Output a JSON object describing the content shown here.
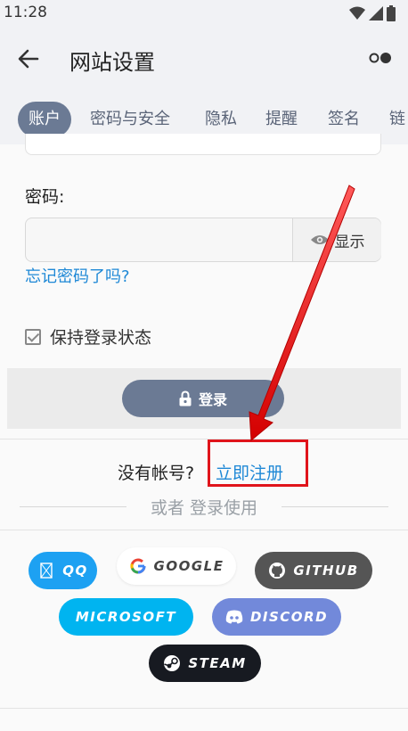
{
  "status": {
    "time": "11:28"
  },
  "header": {
    "title": "网站设置"
  },
  "tabs": [
    {
      "label": "账户"
    },
    {
      "label": "密码与安全"
    },
    {
      "label": "隐私"
    },
    {
      "label": "提醒"
    },
    {
      "label": "签名"
    },
    {
      "label": "链"
    }
  ],
  "form": {
    "password_label": "密码:",
    "password_value": "",
    "show_label": "显示",
    "forgot_link": "忘记密码了吗?",
    "remember_label": "保持登录状态",
    "login_button": "登录"
  },
  "register": {
    "prompt": "没有帐号?",
    "link": "立即注册",
    "or_text": "或者 登录使用"
  },
  "oauth": {
    "qq": "QQ",
    "google": "GOOGLE",
    "github": "GITHUB",
    "microsoft": "MICROSOFT",
    "discord": "DISCORD",
    "steam": "STEAM"
  },
  "colors": {
    "accent": "#6b7a94",
    "link": "#1e88d6",
    "annotation": "#e0141b"
  }
}
